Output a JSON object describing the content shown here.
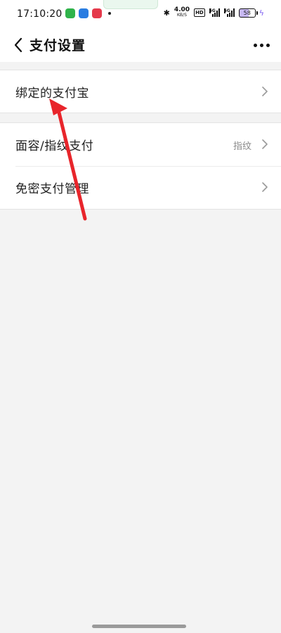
{
  "status_bar": {
    "time": "17:10:20",
    "net_speed": "4.00",
    "net_unit": "KB/S",
    "hd": "HD",
    "signal_1": "5G",
    "signal_2": "5G",
    "battery": "58"
  },
  "nav": {
    "title": "支付设置"
  },
  "groups": [
    {
      "rows": [
        {
          "label": "绑定的支付宝"
        }
      ]
    },
    {
      "rows": [
        {
          "label": "面容/指纹支付",
          "value": "指纹"
        },
        {
          "label": "免密支付管理"
        }
      ]
    }
  ],
  "colors": {
    "background": "#f3f3f3",
    "card": "#ffffff",
    "annotation_arrow": "#e8252b",
    "charging_bolt": "#7b5cf0"
  },
  "icons": {
    "back": "chevron-left-icon",
    "more": "more-horizontal-icon",
    "row_arrow": "chevron-right-icon",
    "bluetooth": "bluetooth-icon",
    "battery": "battery-icon"
  }
}
